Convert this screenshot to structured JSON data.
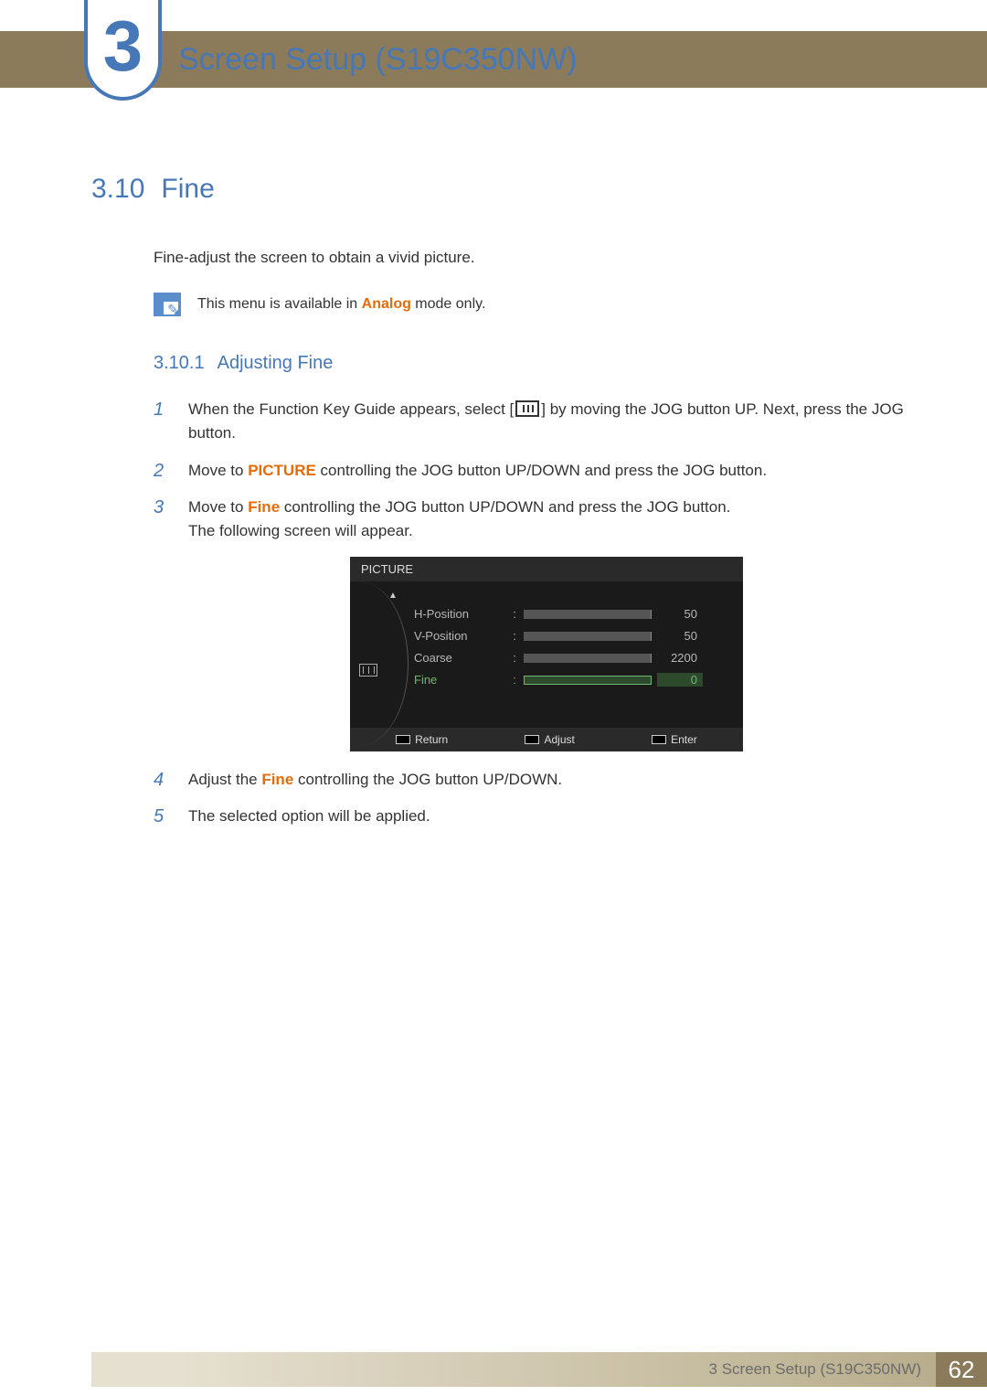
{
  "chapter": {
    "number": "3",
    "title": "Screen Setup (S19C350NW)"
  },
  "section": {
    "number": "3.10",
    "title": "Fine",
    "intro": "Fine-adjust the screen to obtain a vivid picture.",
    "note_prefix": "This menu is available in ",
    "note_highlight": "Analog",
    "note_suffix": " mode only."
  },
  "subsection": {
    "number": "3.10.1",
    "title": "Adjusting Fine"
  },
  "steps": {
    "s1a": "When the Function Key Guide appears, select [",
    "s1b": "] by moving the JOG button UP. Next, press the JOG button.",
    "s2a": "Move to ",
    "s2_bold": "PICTURE",
    "s2b": " controlling the JOG button UP/DOWN and press the JOG button.",
    "s3a": "Move to ",
    "s3_bold": "Fine",
    "s3b": " controlling the JOG button UP/DOWN and press the JOG button.",
    "s3_line2": "The following screen will appear.",
    "s4a": "Adjust the ",
    "s4_bold": "Fine",
    "s4b": " controlling the JOG button UP/DOWN.",
    "s5": "The selected option will be applied.",
    "nums": {
      "n1": "1",
      "n2": "2",
      "n3": "3",
      "n4": "4",
      "n5": "5"
    }
  },
  "osd": {
    "title": "PICTURE",
    "rows": [
      {
        "label": "H-Position",
        "value": "50",
        "fill": 50,
        "active": false
      },
      {
        "label": "V-Position",
        "value": "50",
        "fill": 50,
        "active": false
      },
      {
        "label": "Coarse",
        "value": "2200",
        "fill": 78,
        "active": false
      },
      {
        "label": "Fine",
        "value": "0",
        "fill": 2,
        "active": true
      }
    ],
    "footer": {
      "return": "Return",
      "adjust": "Adjust",
      "enter": "Enter"
    }
  },
  "footer": {
    "text_prefix": "3 ",
    "text": "Screen Setup (S19C350NW)",
    "page": "62"
  }
}
